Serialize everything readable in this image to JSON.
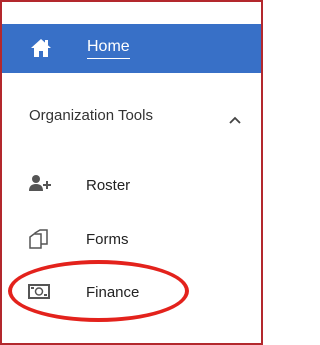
{
  "topbar": {
    "home_label": "Home",
    "home_icon": "home-icon",
    "background": "#3870c7"
  },
  "section": {
    "title": "Organization Tools",
    "toggle_icon": "chevron-up-icon"
  },
  "nav": {
    "items": [
      {
        "label": "Roster",
        "icon": "add-user-icon"
      },
      {
        "label": "Forms",
        "icon": "forms-icon"
      },
      {
        "label": "Finance",
        "icon": "money-icon"
      }
    ]
  },
  "annotation": {
    "highlight": "red-circle-around-finance",
    "color": "#e3221c"
  },
  "frame_color": "#b3282d"
}
